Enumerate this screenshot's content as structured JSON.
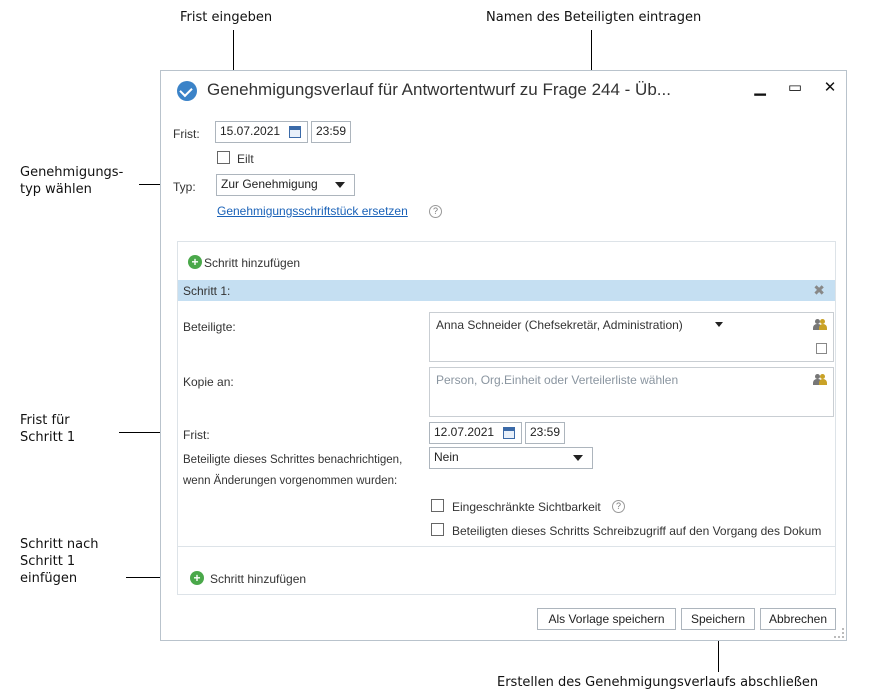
{
  "annotations": {
    "deadline": "Frist eingeben",
    "participants": "Namen des Beteiligten eintragen",
    "type": "Genehmigungs-\ntyp wählen",
    "step_deadline": "Frist für\nSchritt 1",
    "insert_step": "Schritt nach\nSchritt 1\neinfügen",
    "finish": "Erstellen des Genehmigungsverlaufs abschließen"
  },
  "dialog": {
    "title": "Genehmigungsverlauf für Antwortentwurf zu Frage 244 - Üb...",
    "frist_label": "Frist:",
    "frist_date": "15.07.2021",
    "frist_time": "23:59",
    "eilt_label": "Eilt",
    "typ_label": "Typ:",
    "typ_value": "Zur Genehmigung",
    "replace_link": "Genehmigungsschriftstück ersetzen",
    "add_step_top": "Schritt hinzufügen",
    "step_header": "Schritt 1:",
    "beteiligte_label": "Beteiligte:",
    "beteiligte_value": "Anna Schneider (Chefsekretär, Administration)",
    "kopie_label": "Kopie an:",
    "kopie_placeholder": "Person, Org.Einheit oder Verteilerliste wählen",
    "step_frist_label": "Frist:",
    "step_frist_date": "12.07.2021",
    "step_frist_time": "23:59",
    "notify_label_1": "Beteiligte dieses Schrittes benachrichtigen,",
    "notify_label_2": "wenn Änderungen vorgenommen wurden:",
    "notify_value": "Nein",
    "restricted_label": "Eingeschränkte Sichtbarkeit",
    "write_access_label": "Beteiligten dieses Schritts Schreibzugriff auf den Vorgang des Dokum",
    "add_step_bottom": "Schritt hinzufügen",
    "btn_template": "Als Vorlage speichern",
    "btn_save": "Speichern",
    "btn_cancel": "Abbrechen"
  },
  "icons": {
    "app": "approval-check-icon",
    "calendar": "calendar-icon",
    "help": "help-icon",
    "plus": "add-circle-icon",
    "close_step": "remove-step-icon",
    "people": "people-picker-icon"
  },
  "colors": {
    "step_header_bg": "#c5dff2",
    "link": "#1a62b8",
    "plus": "#4aa84a"
  }
}
